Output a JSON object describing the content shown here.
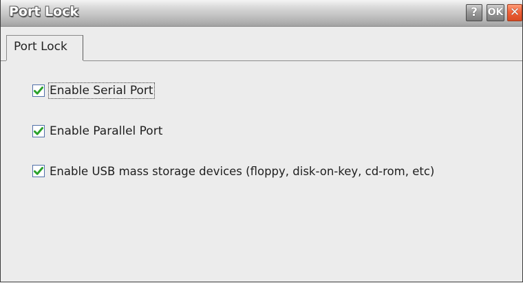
{
  "window": {
    "title": "Port Lock",
    "help_label": "?",
    "ok_label": "OK",
    "close_label": "✕"
  },
  "tabs": [
    {
      "label": "Port Lock",
      "selected": true
    }
  ],
  "options": [
    {
      "label": "Enable Serial Port",
      "checked": true,
      "focused": true
    },
    {
      "label": "Enable Parallel Port",
      "checked": true,
      "focused": false
    },
    {
      "label": "Enable USB mass storage devices (floppy, disk-on-key, cd-rom, etc)",
      "checked": true,
      "focused": false
    }
  ],
  "colors": {
    "check_green": "#2aa12a",
    "checkbox_border": "#4f6fa8",
    "close_red": "#f0623a"
  }
}
